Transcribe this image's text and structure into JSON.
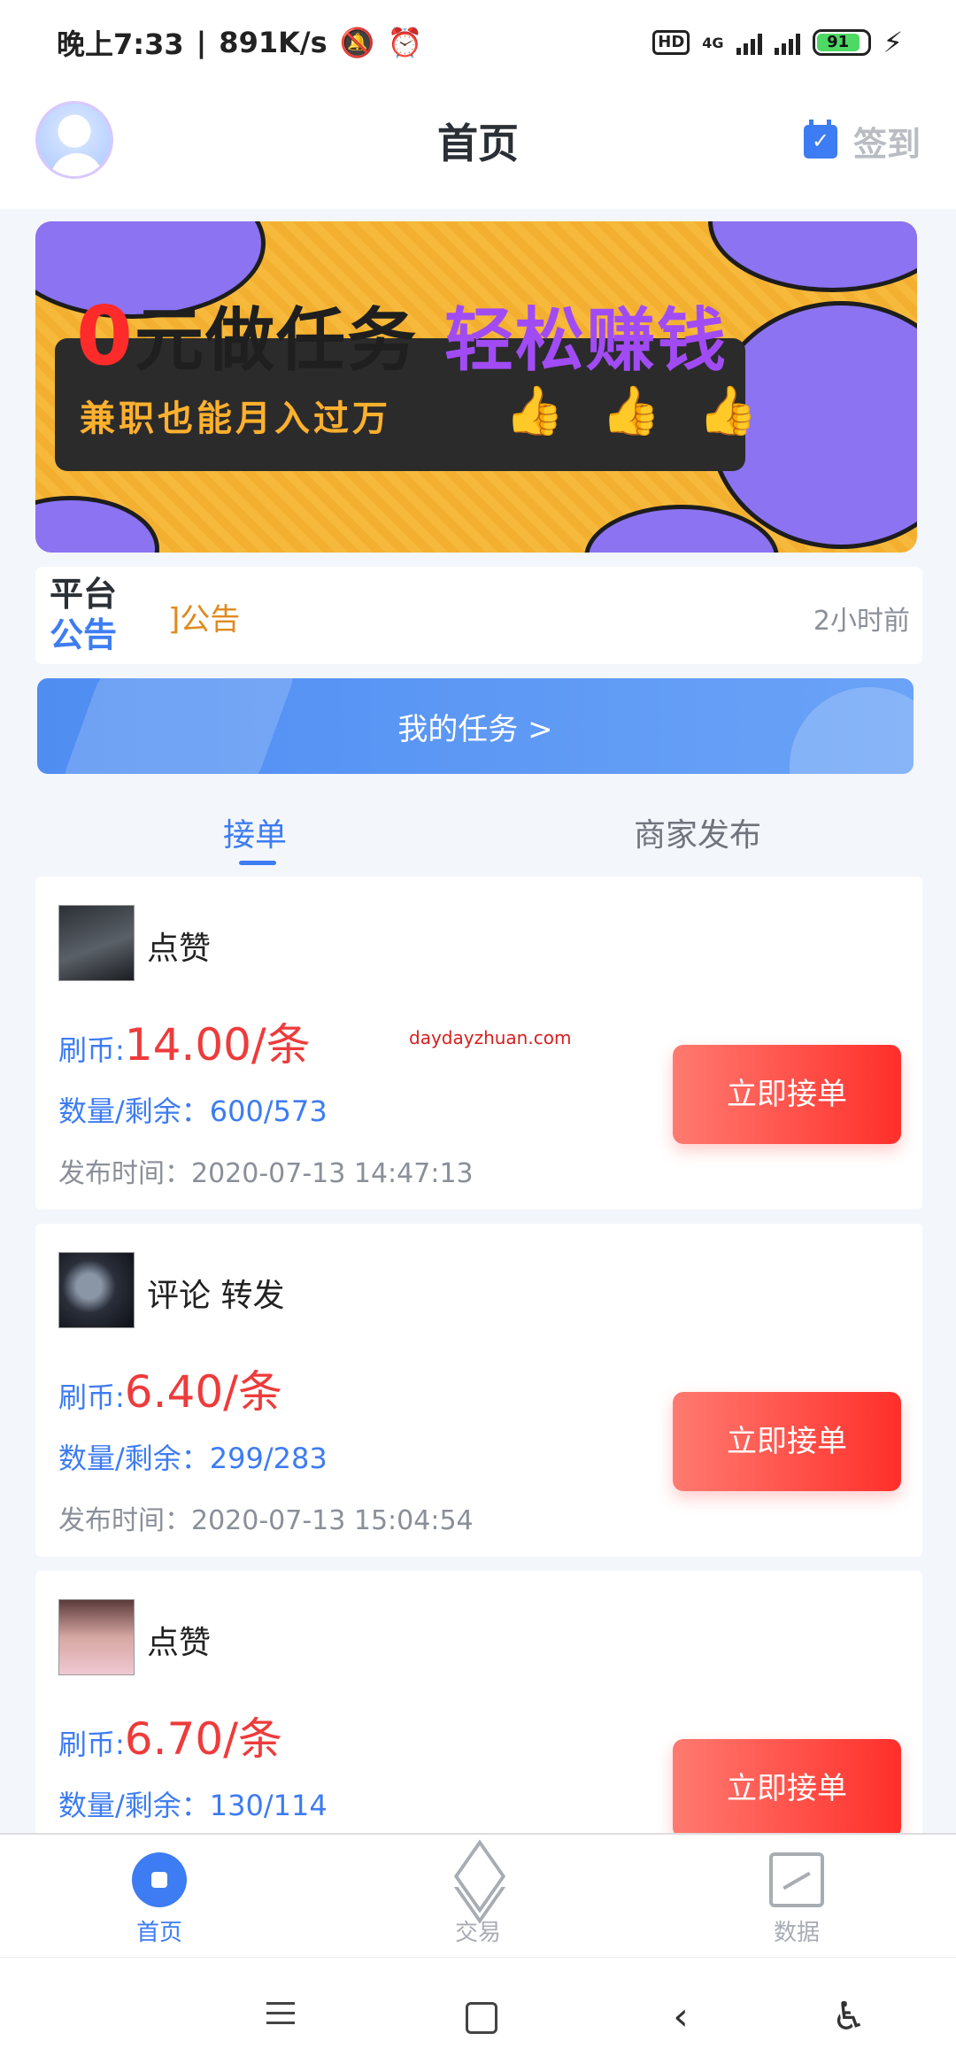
{
  "status_bar": {
    "time": "晚上7:33",
    "speed": "891K/s",
    "hd": "HD",
    "net": "4G",
    "battery": "91"
  },
  "header": {
    "title": "首页",
    "signin": "签到"
  },
  "banner": {
    "zero": "0",
    "title_rest": "元做任务",
    "title_purple": "轻松赚钱",
    "subtitle": "兼职也能月入过万"
  },
  "notice": {
    "badge_line1": "平台",
    "badge_line2": "公告",
    "text": "]公告",
    "time": "2小时前"
  },
  "my_task": {
    "label": "我的任务 >"
  },
  "tabs": {
    "active": "接单",
    "inactive": "商家发布"
  },
  "watermark": "daydayzhuan.com",
  "tasks": [
    {
      "title": "点赞",
      "price_label": "刷币:",
      "price": "14.00/条",
      "qty": "数量/剩余：600/573",
      "time": "发布时间：2020-07-13 14:47:13",
      "button": "立即接单"
    },
    {
      "title": "评论 转发",
      "price_label": "刷币:",
      "price": "6.40/条",
      "qty": "数量/剩余：299/283",
      "time": "发布时间：2020-07-13 15:04:54",
      "button": "立即接单"
    },
    {
      "title": "点赞",
      "price_label": "刷币:",
      "price": "6.70/条",
      "qty": "数量/剩余：130/114",
      "button": "立即接单"
    }
  ],
  "bottom_nav": {
    "home": "首页",
    "trade": "交易",
    "data": "数据"
  },
  "colors": {
    "accent": "#3d7cf2",
    "price_red": "#ee3b3b",
    "button_red": "#ff2f2a",
    "banner_yellow": "#f6b93b",
    "banner_purple": "#8b73f2"
  }
}
